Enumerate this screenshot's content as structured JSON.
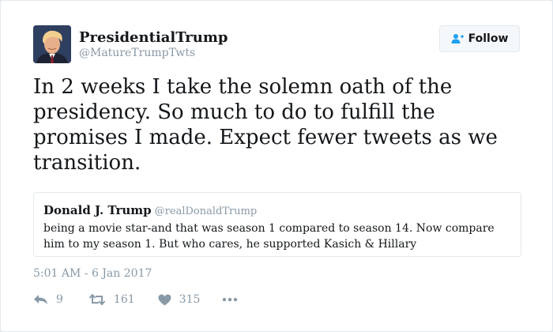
{
  "account": {
    "display_name": "PresidentialTrump",
    "handle": "@MatureTrumpTwts"
  },
  "follow_button": {
    "label": "Follow",
    "icon": "add-user-icon"
  },
  "tweet": {
    "text": "In 2 weeks I take the solemn oath of the presidency. So much to do to fulfill the promises I made. Expect fewer tweets as we transition.",
    "timestamp": "5:01 AM - 6 Jan 2017"
  },
  "quoted_tweet": {
    "display_name": "Donald J. Trump",
    "handle": "@realDonaldTrump",
    "text": "being a movie star-and that was season 1 compared to season 14. Now compare him to my season 1. But who cares, he supported Kasich & Hillary"
  },
  "actions": {
    "reply_count": "9",
    "retweet_count": "161",
    "like_count": "315"
  },
  "colors": {
    "accent": "#1da1f2",
    "text": "#14171a",
    "secondary_text": "#8899a6",
    "border": "#e1e8ed"
  }
}
